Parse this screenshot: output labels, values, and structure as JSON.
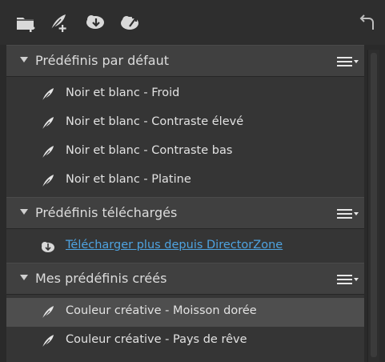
{
  "toolbar": {
    "icons": [
      "folder-add-icon",
      "feather-add-icon",
      "download-icon",
      "upload-icon",
      "undo-icon"
    ]
  },
  "sections": [
    {
      "title": "Prédéfinis par défaut",
      "items": [
        {
          "label": "Noir et blanc - Froid",
          "icon": "feather-icon"
        },
        {
          "label": "Noir et blanc - Contraste élevé",
          "icon": "feather-icon"
        },
        {
          "label": "Noir et blanc - Contraste bas",
          "icon": "feather-icon"
        },
        {
          "label": "Noir et blanc - Platine",
          "icon": "feather-icon"
        }
      ]
    },
    {
      "title": "Prédéfinis téléchargés",
      "items": [
        {
          "label": "Télécharger plus depuis DirectorZone",
          "icon": "download-cloud-icon",
          "link": true
        }
      ]
    },
    {
      "title": "Mes prédéfinis créés",
      "items": [
        {
          "label": "Couleur créative - Moisson dorée",
          "icon": "feather-icon",
          "selected": true
        },
        {
          "label": "Couleur créative - Pays de rêve",
          "icon": "feather-icon"
        }
      ]
    }
  ],
  "colors": {
    "background": "#2a2a2a",
    "header": "#404040",
    "selected": "#4e4e4e",
    "link": "#4ea3e0"
  }
}
